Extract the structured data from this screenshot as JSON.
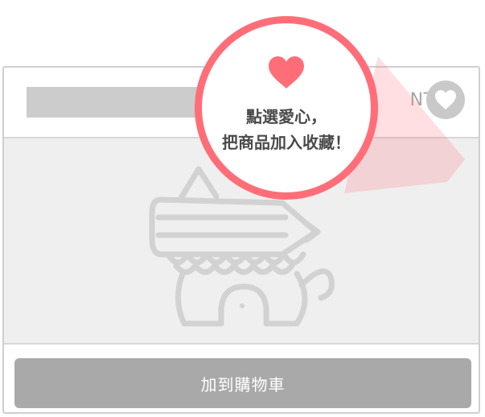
{
  "product": {
    "price": "NT$ 0",
    "add_to_cart_label": "加到購物車"
  },
  "tooltip": {
    "line1": "點選愛心，",
    "line2": "把商品加入收藏！"
  },
  "icons": {
    "favorite": "heart-icon",
    "tooltip": "heart-icon",
    "image_placeholder": "pencil-elephant-placeholder"
  },
  "colors": {
    "accent": "#ff6e78",
    "placeholder_gray": "#cccccc",
    "button_gray": "#a9a9a9",
    "price_gray": "#a6a6a6"
  }
}
